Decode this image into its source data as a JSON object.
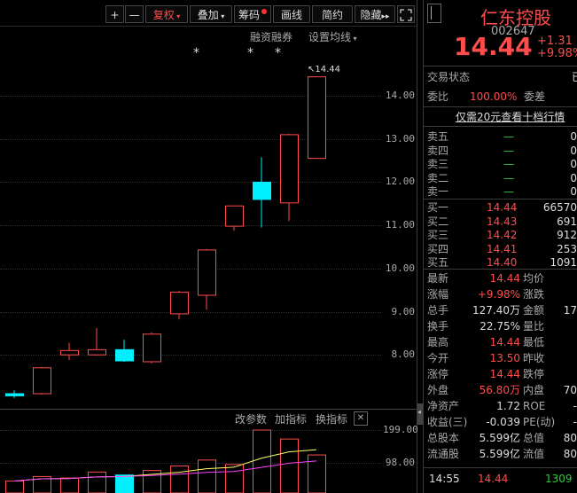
{
  "toolbar": {
    "plus": "+",
    "minus": "—",
    "fuquan": "复权",
    "diejia": "叠加",
    "chouma": "筹码",
    "huaxian": "画线",
    "jianyue": "简约",
    "yincang": "隐藏",
    "expand_glyph": "⛶"
  },
  "chart_links": {
    "margin": "融资融券",
    "ma_settings": "设置均线",
    "change_params": "改参数",
    "add_indicator": "加指标",
    "switch_indicator": "换指标",
    "close": "✕"
  },
  "price_axis": [
    "14.00",
    "13.00",
    "12.00",
    "11.00",
    "10.00",
    "9.00",
    "8.00"
  ],
  "volume_axis": [
    "199.00",
    "98.00"
  ],
  "high_label": "14.44",
  "stars": [
    "*",
    "*",
    "*"
  ],
  "chart_data": {
    "type": "candlestick",
    "ylim": [
      7.1,
      14.7
    ],
    "candles": [
      {
        "o": 7.1,
        "c": 7.05,
        "h": 7.18,
        "l": 7.0
      },
      {
        "o": 7.1,
        "c": 7.7,
        "h": 7.72,
        "l": 7.08
      },
      {
        "o": 8.0,
        "c": 8.1,
        "h": 8.28,
        "l": 7.88
      },
      {
        "o": 8.0,
        "c": 8.12,
        "h": 8.62,
        "l": 7.98
      },
      {
        "o": 8.12,
        "c": 7.86,
        "h": 8.35,
        "l": 7.84
      },
      {
        "o": 7.84,
        "c": 8.48,
        "h": 8.52,
        "l": 7.8
      },
      {
        "o": 8.95,
        "c": 9.45,
        "h": 9.48,
        "l": 8.82
      },
      {
        "o": 9.38,
        "c": 10.43,
        "h": 10.45,
        "l": 9.05
      },
      {
        "o": 10.98,
        "c": 11.45,
        "h": 11.45,
        "l": 10.88
      },
      {
        "o": 12.0,
        "c": 11.6,
        "h": 12.58,
        "l": 10.95
      },
      {
        "o": 11.52,
        "c": 13.1,
        "h": 13.12,
        "l": 11.1
      },
      {
        "o": 12.55,
        "c": 14.44,
        "h": 14.44,
        "l": 12.9
      }
    ],
    "volumes": [
      {
        "v": 40,
        "up": true
      },
      {
        "v": 55,
        "up": true
      },
      {
        "v": 50,
        "up": true
      },
      {
        "v": 70,
        "up": true
      },
      {
        "v": 60,
        "up": false
      },
      {
        "v": 75,
        "up": true
      },
      {
        "v": 90,
        "up": true
      },
      {
        "v": 110,
        "up": true
      },
      {
        "v": 95,
        "up": true
      },
      {
        "v": 210,
        "up": true
      },
      {
        "v": 180,
        "up": true
      },
      {
        "v": 127,
        "up": true
      }
    ],
    "vol_ylim": [
      0,
      210
    ]
  },
  "quote": {
    "name": "仁东控股",
    "code": "002647",
    "price": "14.44",
    "change": "+1.31",
    "change_pct": "+9.98%"
  },
  "status": {
    "label": "交易状态",
    "value": "已",
    "webi_label": "委比",
    "webi_value": "100.00%",
    "weicha_label": "委差",
    "promo": "仅需20元查看十档行情"
  },
  "sells": [
    {
      "label": "卖五",
      "price": "—",
      "vol": "0"
    },
    {
      "label": "卖四",
      "price": "—",
      "vol": "0"
    },
    {
      "label": "卖三",
      "price": "—",
      "vol": "0"
    },
    {
      "label": "卖二",
      "price": "—",
      "vol": "0"
    },
    {
      "label": "卖一",
      "price": "—",
      "vol": "0"
    }
  ],
  "buys": [
    {
      "label": "买一",
      "price": "14.44",
      "vol": "66570"
    },
    {
      "label": "买二",
      "price": "14.43",
      "vol": "691"
    },
    {
      "label": "买三",
      "price": "14.42",
      "vol": "912"
    },
    {
      "label": "买四",
      "price": "14.41",
      "vol": "253"
    },
    {
      "label": "买五",
      "price": "14.40",
      "vol": "1091"
    }
  ],
  "stats": [
    {
      "l": "最新",
      "v": "14.44",
      "vc": "red",
      "l2": "均价",
      "v2": ""
    },
    {
      "l": "涨幅",
      "v": "+9.98%",
      "vc": "red",
      "l2": "涨跌",
      "v2": ""
    },
    {
      "l": "总手",
      "v": "127.40万",
      "vc": "white",
      "l2": "金额",
      "v2": "17"
    },
    {
      "l": "换手",
      "v": "22.75%",
      "vc": "white",
      "l2": "量比",
      "v2": ""
    },
    {
      "l": "最高",
      "v": "14.44",
      "vc": "red",
      "l2": "最低",
      "v2": ""
    },
    {
      "l": "今开",
      "v": "13.50",
      "vc": "red",
      "l2": "昨收",
      "v2": ""
    },
    {
      "l": "涨停",
      "v": "14.44",
      "vc": "red",
      "l2": "跌停",
      "v2": ""
    },
    {
      "l": "外盘",
      "v": "56.80万",
      "vc": "red",
      "l2": "内盘",
      "v2": "70"
    },
    {
      "l": "净资产",
      "v": "1.72",
      "vc": "white",
      "l2": "ROE",
      "v2": "-"
    },
    {
      "l": "收益(三)",
      "v": "-0.039",
      "vc": "white",
      "l2": "PE(动)",
      "v2": "-"
    },
    {
      "l": "总股本",
      "v": "5.599亿",
      "vc": "white",
      "l2": "总值",
      "v2": "80"
    },
    {
      "l": "流通股",
      "v": "5.599亿",
      "vc": "white",
      "l2": "流值",
      "v2": "80"
    }
  ],
  "tick": {
    "time": "14:55",
    "price": "14.44",
    "vol": "1309"
  },
  "colors": {
    "up": "#ff4c4c",
    "down": "#00f0ff",
    "ma1": "#ffff66",
    "ma2": "#ff44ff"
  }
}
